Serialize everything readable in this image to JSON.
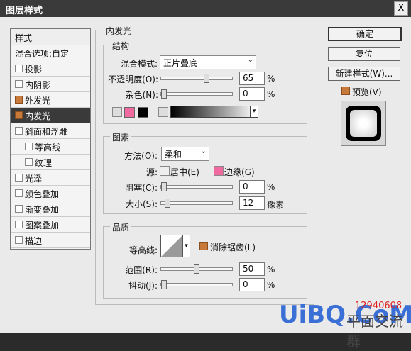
{
  "window": {
    "title": "图层样式",
    "close_label": "X"
  },
  "style_list": {
    "header": "样式",
    "blend_options": "混合选项:自定",
    "items": [
      {
        "label": "投影",
        "checked": false,
        "selected": false
      },
      {
        "label": "内阴影",
        "checked": false,
        "selected": false
      },
      {
        "label": "外发光",
        "checked": true,
        "selected": false
      },
      {
        "label": "内发光",
        "checked": true,
        "selected": true
      },
      {
        "label": "斜面和浮雕",
        "checked": false,
        "selected": false
      },
      {
        "label": "等高线",
        "checked": false,
        "selected": false
      },
      {
        "label": "纹理",
        "checked": false,
        "selected": false
      },
      {
        "label": "光泽",
        "checked": false,
        "selected": false
      },
      {
        "label": "颜色叠加",
        "checked": false,
        "selected": false
      },
      {
        "label": "渐变叠加",
        "checked": false,
        "selected": false
      },
      {
        "label": "图案叠加",
        "checked": false,
        "selected": false
      },
      {
        "label": "描边",
        "checked": false,
        "selected": false
      }
    ]
  },
  "panel": {
    "title": "内发光",
    "structure": {
      "title": "结构",
      "blend_mode_label": "混合模式:",
      "blend_mode_value": "正片叠底",
      "opacity_label": "不透明度(O):",
      "opacity_value": "65",
      "opacity_fraction": 0.65,
      "noise_label": "杂色(N):",
      "noise_value": "0",
      "noise_fraction": 0,
      "percent": "%",
      "glow_color": "#f06aa0",
      "color_black": "#000000"
    },
    "elements": {
      "title": "图素",
      "technique_label": "方法(O):",
      "technique_value": "柔和",
      "source_label": "源:",
      "source_center": "居中(E)",
      "source_edge": "边缘(G)",
      "choke_label": "阻塞(C):",
      "choke_value": "0",
      "choke_fraction": 0,
      "size_label": "大小(S):",
      "size_value": "12",
      "size_fraction": 0.05,
      "size_unit": "像素",
      "edge_color": "#f06aa0"
    },
    "quality": {
      "title": "品质",
      "contour_label": "等高线:",
      "anti_alias_label": "消除锯齿(L)",
      "range_label": "范围(R):",
      "range_value": "50",
      "range_fraction": 0.5,
      "jitter_label": "抖动(J):",
      "jitter_value": "0",
      "jitter_fraction": 0,
      "percent": "%"
    }
  },
  "buttons": {
    "ok": "确定",
    "reset": "复位",
    "new_style": "新建样式(W)...",
    "preview_label": "预览(V)"
  },
  "watermark": {
    "site": "UiBQ.CoM",
    "number": "12940608",
    "text": "平面交流群"
  },
  "accent_color": "#c87a3a"
}
